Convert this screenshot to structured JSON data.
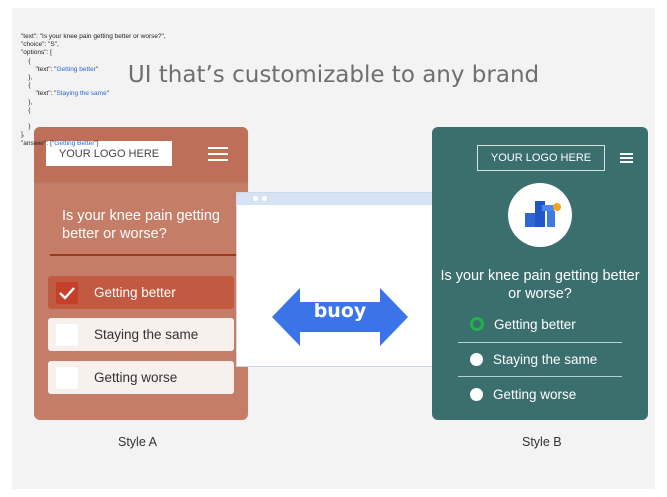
{
  "headline": "UI that’s customizable to any brand",
  "style_a": {
    "logo": "YOUR LOGO HERE",
    "question": "Is your knee pain getting better or worse?",
    "options": [
      "Getting better",
      "Staying the same",
      "Getting worse"
    ],
    "selected_index": 0,
    "caption": "Style A",
    "colors": {
      "background": "#c67d68",
      "topbar": "#bd6f57",
      "selected": "#c15a40"
    }
  },
  "code_window": {
    "lines": [
      "\"text\": \"Is your knee pain getting better or worse?\",",
      "\"choice\": \"S\",",
      "\"options\": [",
      "    {",
      "        \"text\": \"Getting better\"",
      "    },",
      "    {",
      "        \"text\": \"Staying the same\"",
      "    },",
      "    {",
      "",
      "    }",
      "],",
      "\"answer\": [\"Getting Better\"]"
    ],
    "brand": "buoy",
    "colors": {
      "arrow": "#3b74e8",
      "titlebar": "#d6e3f4"
    }
  },
  "style_b": {
    "logo": "YOUR LOGO HERE",
    "question": "Is your knee pain getting better or worse?",
    "options": [
      "Getting better",
      "Staying the same",
      "Getting worse"
    ],
    "selected_index": 0,
    "caption": "Style B",
    "colors": {
      "background": "#3a6f6e",
      "selected_radio": "#22b24c"
    }
  }
}
